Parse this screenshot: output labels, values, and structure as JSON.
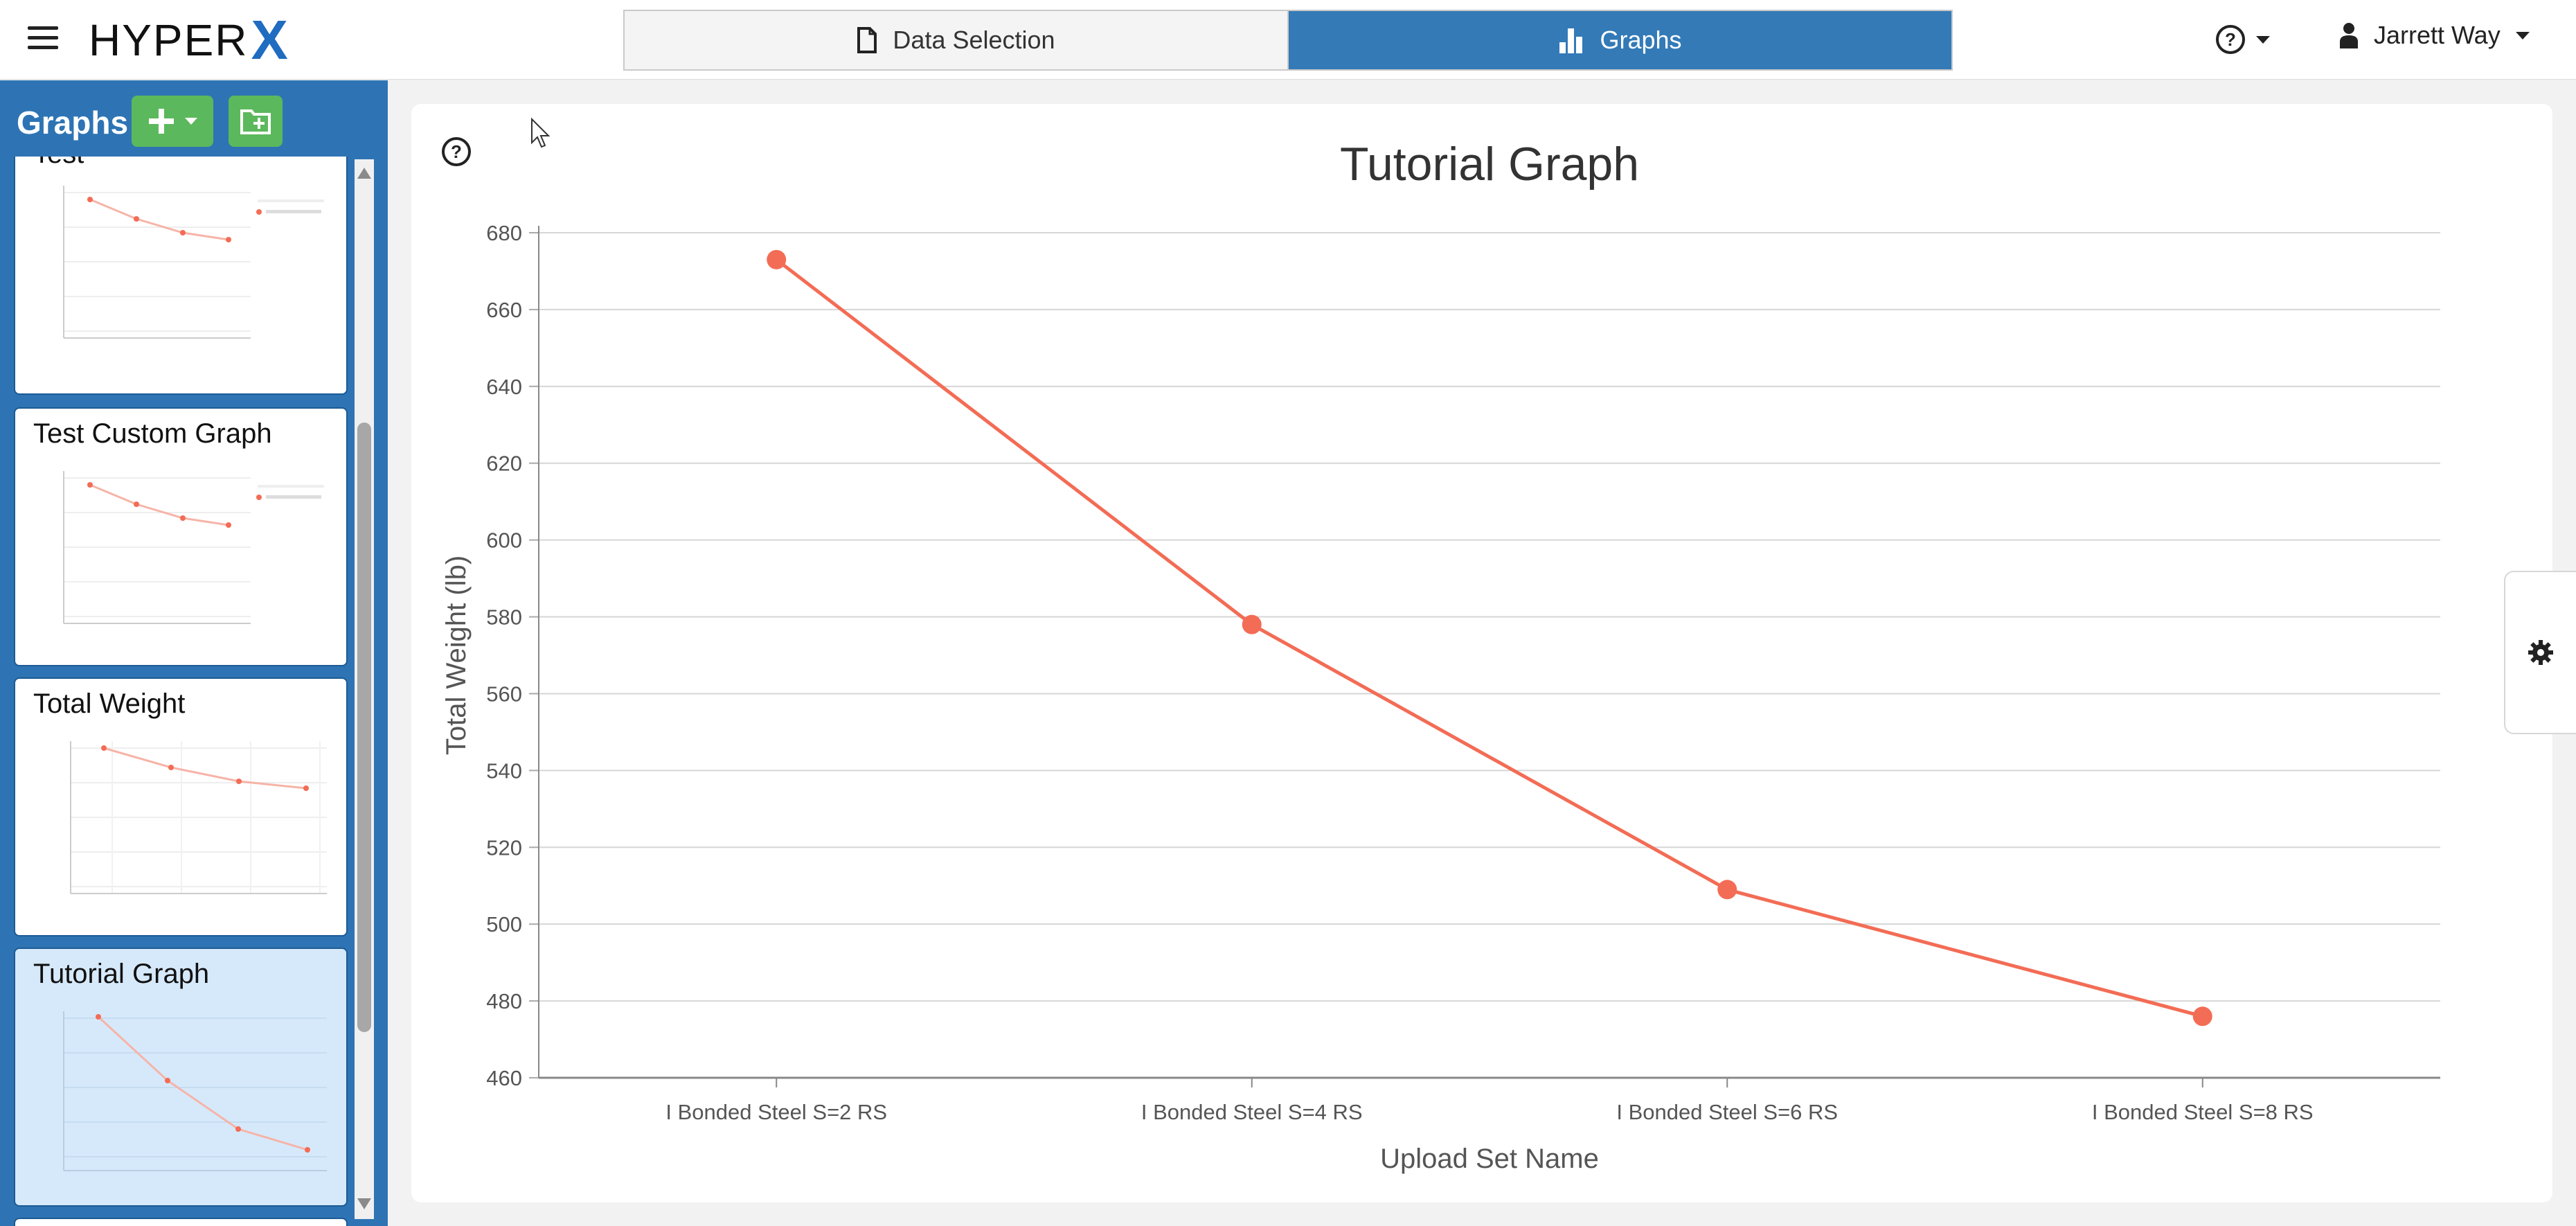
{
  "app": {
    "logo_text": "HYPER",
    "logo_mark": "X"
  },
  "header": {
    "tabs": [
      {
        "label": "Data Selection",
        "icon": "document-icon",
        "active": false
      },
      {
        "label": "Graphs",
        "icon": "bar-chart-icon",
        "active": true
      }
    ],
    "help_icon": "help-circle-icon",
    "user_name": "Jarrett Way"
  },
  "sidebar": {
    "title": "Graphs",
    "add_icon": "plus-icon",
    "folder_icon": "folder-add-icon",
    "cards": [
      {
        "title": "Test",
        "selected": false
      },
      {
        "title": "Test Custom Graph",
        "selected": false
      },
      {
        "title": "Total Weight",
        "selected": false
      },
      {
        "title": "Tutorial Graph",
        "selected": true
      }
    ]
  },
  "colors": {
    "accent": "#337ab7",
    "sidebar": "#2e74b4",
    "green": "#5cb85c",
    "series": "#f36c55"
  },
  "chart_data": {
    "type": "line",
    "title": "Tutorial Graph",
    "xlabel": "Upload Set Name",
    "ylabel": "Total Weight (lb)",
    "categories": [
      "I Bonded Steel S=2 RS",
      "I Bonded Steel S=4 RS",
      "I Bonded Steel S=6 RS",
      "I Bonded Steel S=8 RS"
    ],
    "series": [
      {
        "values": [
          673,
          578,
          509,
          476
        ]
      }
    ],
    "ylim": [
      460,
      680
    ],
    "yticks": [
      460,
      480,
      500,
      520,
      540,
      560,
      580,
      600,
      620,
      640,
      660,
      680
    ],
    "grid": true
  }
}
